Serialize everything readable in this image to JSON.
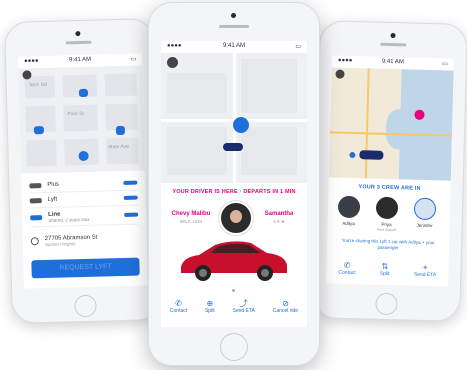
{
  "left_phone": {
    "status_time": "9:41 AM",
    "map_labels": [
      "Tech Rd",
      "Park St",
      "Main Ave"
    ],
    "rides": [
      {
        "name": "Plus"
      },
      {
        "name": "Lyft"
      },
      {
        "name": "Line",
        "detail": "Shared, 2 stops max"
      }
    ],
    "destination": "27705 Abramson St",
    "destination_sub": "Sunset Heights",
    "request_label": "REQUEST LYFT"
  },
  "center_phone": {
    "status_time": "9:41 AM",
    "banner": "YOUR DRIVER IS HERE · DEPARTS IN 1 MIN",
    "car_model": "Chevy Malibu",
    "plate": "6ELK 1234",
    "driver_name": "Samantha",
    "driver_rating": "4.9 ★",
    "tabs": [
      {
        "icon": "phone-icon",
        "glyph": "✆",
        "label": "Contact"
      },
      {
        "icon": "split-icon",
        "glyph": "⊕",
        "label": "Split"
      },
      {
        "icon": "share-icon",
        "glyph": "⤴",
        "label": "Send ETA"
      },
      {
        "icon": "cancel-icon",
        "glyph": "⊘",
        "label": "Cancel ride"
      }
    ]
  },
  "right_phone": {
    "status_time": "9:41 AM",
    "banner": "YOUR 3 CREW ARE IN",
    "riders": [
      {
        "name": "Aditya",
        "sub": ""
      },
      {
        "name": "Priya",
        "sub": "Next dropoff"
      },
      {
        "name": "Jennifer",
        "sub": ""
      }
    ],
    "message": "You're sharing this Lyft 1 car with Aditya + your passenger",
    "tabs": [
      {
        "icon": "phone-icon",
        "glyph": "✆",
        "label": "Contact"
      },
      {
        "icon": "split-icon",
        "glyph": "⇅",
        "label": "Split"
      },
      {
        "icon": "pin-icon",
        "glyph": "⌖",
        "label": "Send ETA"
      }
    ]
  },
  "colors": {
    "accent": "#1e6fd9",
    "pink": "#e6007e",
    "car_red": "#c8102e"
  }
}
